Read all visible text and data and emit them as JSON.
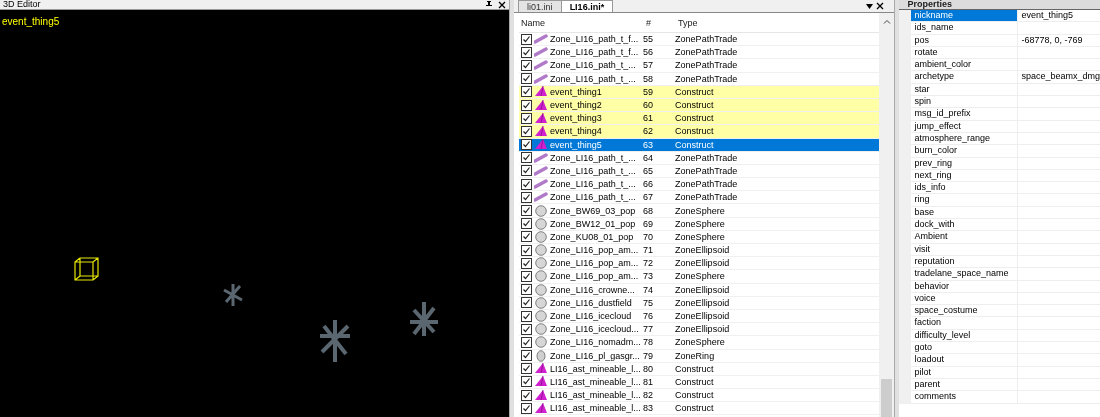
{
  "editor": {
    "title": "3D Editor",
    "selection_label": "event_thing5"
  },
  "tabs": [
    {
      "label": "li01.ini",
      "selected": false
    },
    {
      "label": "LI16.ini*",
      "selected": true
    }
  ],
  "table": {
    "columns": [
      "Name",
      "#",
      "Type"
    ],
    "rows": [
      {
        "kind": "path",
        "name": "Zone_LI16_path_t_f...",
        "num": "55",
        "type": "ZonePathTrade",
        "checked": true,
        "highlighted": false,
        "selected": false
      },
      {
        "kind": "path",
        "name": "Zone_LI16_path_t_f...",
        "num": "56",
        "type": "ZonePathTrade",
        "checked": true,
        "highlighted": false,
        "selected": false
      },
      {
        "kind": "path",
        "name": "Zone_LI16_path_t_...",
        "num": "57",
        "type": "ZonePathTrade",
        "checked": true,
        "highlighted": false,
        "selected": false
      },
      {
        "kind": "path",
        "name": "Zone_LI16_path_t_...",
        "num": "58",
        "type": "ZonePathTrade",
        "checked": true,
        "highlighted": false,
        "selected": false
      },
      {
        "kind": "construct",
        "name": "event_thing1",
        "num": "59",
        "type": "Construct",
        "checked": true,
        "highlighted": true,
        "selected": false
      },
      {
        "kind": "construct",
        "name": "event_thing2",
        "num": "60",
        "type": "Construct",
        "checked": true,
        "highlighted": true,
        "selected": false
      },
      {
        "kind": "construct",
        "name": "event_thing3",
        "num": "61",
        "type": "Construct",
        "checked": true,
        "highlighted": true,
        "selected": false
      },
      {
        "kind": "construct",
        "name": "event_thing4",
        "num": "62",
        "type": "Construct",
        "checked": true,
        "highlighted": true,
        "selected": false
      },
      {
        "kind": "construct",
        "name": "event_thing5",
        "num": "63",
        "type": "Construct",
        "checked": true,
        "highlighted": false,
        "selected": true
      },
      {
        "kind": "path",
        "name": "Zone_LI16_path_t_...",
        "num": "64",
        "type": "ZonePathTrade",
        "checked": true,
        "highlighted": false,
        "selected": false
      },
      {
        "kind": "path",
        "name": "Zone_LI16_path_t_...",
        "num": "65",
        "type": "ZonePathTrade",
        "checked": true,
        "highlighted": false,
        "selected": false
      },
      {
        "kind": "path",
        "name": "Zone_LI16_path_t_...",
        "num": "66",
        "type": "ZonePathTrade",
        "checked": true,
        "highlighted": false,
        "selected": false
      },
      {
        "kind": "path",
        "name": "Zone_LI16_path_t_...",
        "num": "67",
        "type": "ZonePathTrade",
        "checked": true,
        "highlighted": false,
        "selected": false
      },
      {
        "kind": "sphere",
        "name": "Zone_BW69_03_pop",
        "num": "68",
        "type": "ZoneSphere",
        "checked": true,
        "highlighted": false,
        "selected": false
      },
      {
        "kind": "sphere",
        "name": "Zone_BW12_01_pop",
        "num": "69",
        "type": "ZoneSphere",
        "checked": true,
        "highlighted": false,
        "selected": false
      },
      {
        "kind": "sphere",
        "name": "Zone_KU08_01_pop",
        "num": "70",
        "type": "ZoneSphere",
        "checked": true,
        "highlighted": false,
        "selected": false
      },
      {
        "kind": "sphere",
        "name": "Zone_LI16_pop_am...",
        "num": "71",
        "type": "ZoneEllipsoid",
        "checked": true,
        "highlighted": false,
        "selected": false
      },
      {
        "kind": "sphere",
        "name": "Zone_LI16_pop_am...",
        "num": "72",
        "type": "ZoneEllipsoid",
        "checked": true,
        "highlighted": false,
        "selected": false
      },
      {
        "kind": "sphere",
        "name": "Zone_LI16_pop_am...",
        "num": "73",
        "type": "ZoneSphere",
        "checked": true,
        "highlighted": false,
        "selected": false
      },
      {
        "kind": "sphere",
        "name": "Zone_LI16_crowne...",
        "num": "74",
        "type": "ZoneEllipsoid",
        "checked": true,
        "highlighted": false,
        "selected": false
      },
      {
        "kind": "sphere",
        "name": "Zone_LI16_dustfield",
        "num": "75",
        "type": "ZoneEllipsoid",
        "checked": true,
        "highlighted": false,
        "selected": false
      },
      {
        "kind": "sphere",
        "name": "Zone_LI16_icecloud",
        "num": "76",
        "type": "ZoneEllipsoid",
        "checked": true,
        "highlighted": false,
        "selected": false
      },
      {
        "kind": "sphere",
        "name": "Zone_LI16_icecloud...",
        "num": "77",
        "type": "ZoneEllipsoid",
        "checked": true,
        "highlighted": false,
        "selected": false
      },
      {
        "kind": "sphere",
        "name": "Zone_LI16_nomadm...",
        "num": "78",
        "type": "ZoneSphere",
        "checked": true,
        "highlighted": false,
        "selected": false
      },
      {
        "kind": "ring",
        "name": "Zone_LI16_pl_gasgr...",
        "num": "79",
        "type": "ZoneRing",
        "checked": true,
        "highlighted": false,
        "selected": false
      },
      {
        "kind": "construct",
        "name": "LI16_ast_mineable_l...",
        "num": "80",
        "type": "Construct",
        "checked": true,
        "highlighted": false,
        "selected": false
      },
      {
        "kind": "construct",
        "name": "LI16_ast_mineable_l...",
        "num": "81",
        "type": "Construct",
        "checked": true,
        "highlighted": false,
        "selected": false
      },
      {
        "kind": "construct",
        "name": "LI16_ast_mineable_l...",
        "num": "82",
        "type": "Construct",
        "checked": true,
        "highlighted": false,
        "selected": false
      },
      {
        "kind": "construct",
        "name": "LI16_ast_mineable_l...",
        "num": "83",
        "type": "Construct",
        "checked": true,
        "highlighted": false,
        "selected": false
      }
    ]
  },
  "properties": {
    "title": "Properties",
    "rows": [
      {
        "name": "nickname",
        "value": "event_thing5",
        "selected": true
      },
      {
        "name": "ids_name",
        "selected": false
      },
      {
        "name": "pos",
        "value": "-68778, 0, -769",
        "selected": false
      },
      {
        "name": "rotate",
        "selected": false
      },
      {
        "name": "ambient_color",
        "selected": false
      },
      {
        "name": "archetype",
        "value": "space_beamx_dmg",
        "selected": false
      },
      {
        "name": "star",
        "selected": false
      },
      {
        "name": "spin",
        "selected": false
      },
      {
        "name": "msg_id_prefix",
        "selected": false
      },
      {
        "name": "jump_effect",
        "selected": false
      },
      {
        "name": "atmosphere_range",
        "selected": false
      },
      {
        "name": "burn_color",
        "selected": false
      },
      {
        "name": "prev_ring",
        "selected": false
      },
      {
        "name": "next_ring",
        "selected": false
      },
      {
        "name": "ids_info",
        "selected": false
      },
      {
        "name": "ring",
        "selected": false
      },
      {
        "name": "base",
        "selected": false
      },
      {
        "name": "dock_with",
        "selected": false
      },
      {
        "name": "Ambient",
        "selected": false
      },
      {
        "name": "visit",
        "selected": false
      },
      {
        "name": "reputation",
        "selected": false
      },
      {
        "name": "tradelane_space_name",
        "selected": false
      },
      {
        "name": "behavior",
        "selected": false
      },
      {
        "name": "voice",
        "selected": false
      },
      {
        "name": "space_costume",
        "selected": false
      },
      {
        "name": "faction",
        "selected": false
      },
      {
        "name": "difficulty_level",
        "selected": false
      },
      {
        "name": "goto",
        "selected": false
      },
      {
        "name": "loadout",
        "selected": false
      },
      {
        "name": "pilot",
        "selected": false
      },
      {
        "name": "parent",
        "selected": false
      },
      {
        "name": "comments",
        "selected": false
      }
    ]
  }
}
